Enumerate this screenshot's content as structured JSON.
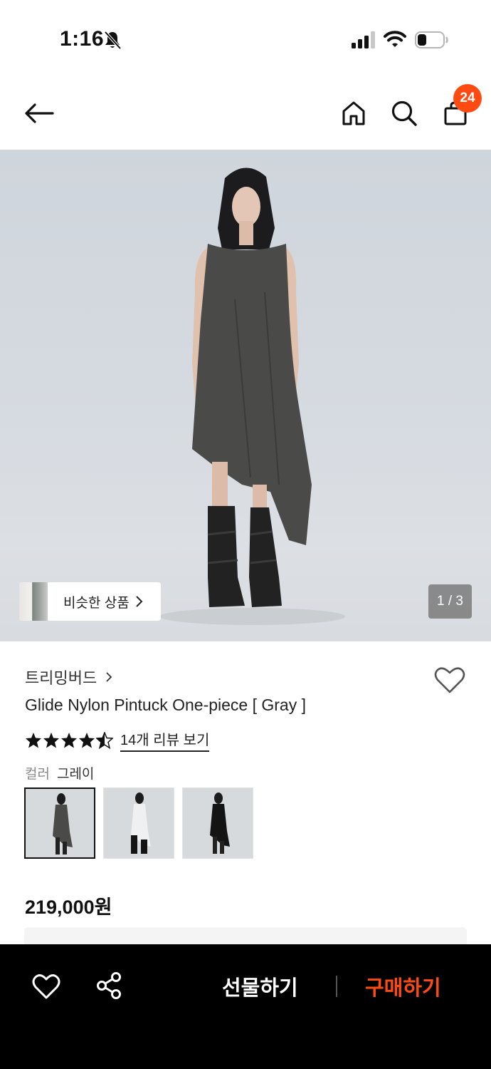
{
  "status_bar": {
    "time": "1:16"
  },
  "header": {
    "cart_count": "24",
    "icons": [
      "back-arrow-icon",
      "home-icon",
      "search-icon",
      "shopping-bag-icon"
    ]
  },
  "hero": {
    "similar_products_label": "비슷한 상품",
    "page_indicator": "1 / 3"
  },
  "product": {
    "brand": "트리밍버드",
    "title": "Glide Nylon Pintuck One-piece [ Gray ]",
    "rating": 4.5,
    "review_link": "14개 리뷰 보기",
    "color_label": "컬러",
    "color_value": "그레이",
    "color_options": [
      {
        "name": "gray",
        "dress_color": "#4a4a48",
        "selected": true
      },
      {
        "name": "white",
        "dress_color": "#eef0f2",
        "selected": false
      },
      {
        "name": "black",
        "dress_color": "#141414",
        "selected": false
      }
    ],
    "price": "219,000원"
  },
  "bottom_bar": {
    "gift_label": "선물하기",
    "buy_label": "구매하기"
  },
  "colors": {
    "accent": "#ff4b12",
    "bottom_bar_bg": "#000000"
  }
}
